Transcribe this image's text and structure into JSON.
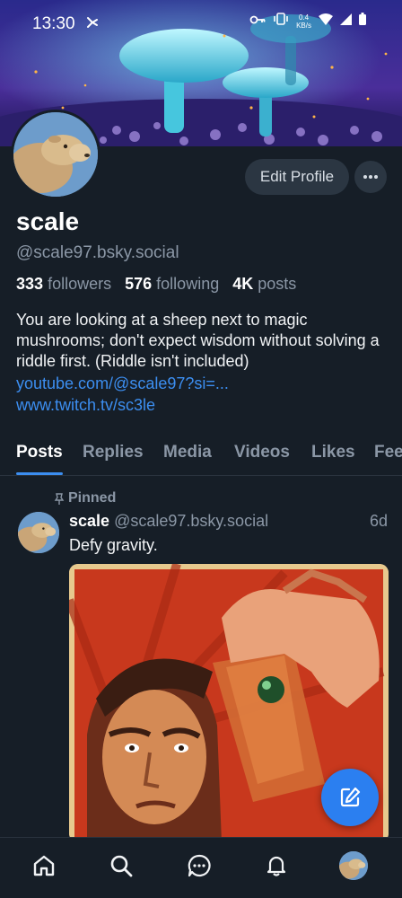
{
  "status_bar": {
    "time": "13:30",
    "net_speed_value": "0.4",
    "net_speed_unit": "KB/s"
  },
  "profile": {
    "display_name": "scale",
    "handle": "@scale97.bsky.social",
    "edit_label": "Edit Profile",
    "followers_count": "333",
    "followers_label": "followers",
    "following_count": "576",
    "following_label": "following",
    "posts_count": "4K",
    "posts_label": "posts",
    "bio": "You are looking at a sheep next to magic mushrooms; don't expect wisdom without solving a riddle first. (Riddle isn't included)",
    "links": [
      "youtube.com/@scale97?si=...",
      "www.twitch.tv/sc3le"
    ]
  },
  "tabs": [
    "Posts",
    "Replies",
    "Media",
    "Videos",
    "Likes",
    "Feeds"
  ],
  "active_tab": "Posts",
  "post": {
    "pinned_label": "Pinned",
    "author_name": "scale",
    "author_handle": "@scale97.bsky.social",
    "time": "6d",
    "text": "Defy gravity."
  },
  "bottom_nav": [
    "home-icon",
    "search-icon",
    "chat-icon",
    "bell-icon",
    "profile-avatar"
  ],
  "colors": {
    "background": "#161e27",
    "accent": "#3c8ef0",
    "fab": "#2b7ff0",
    "muted_text": "#8b97a6"
  }
}
